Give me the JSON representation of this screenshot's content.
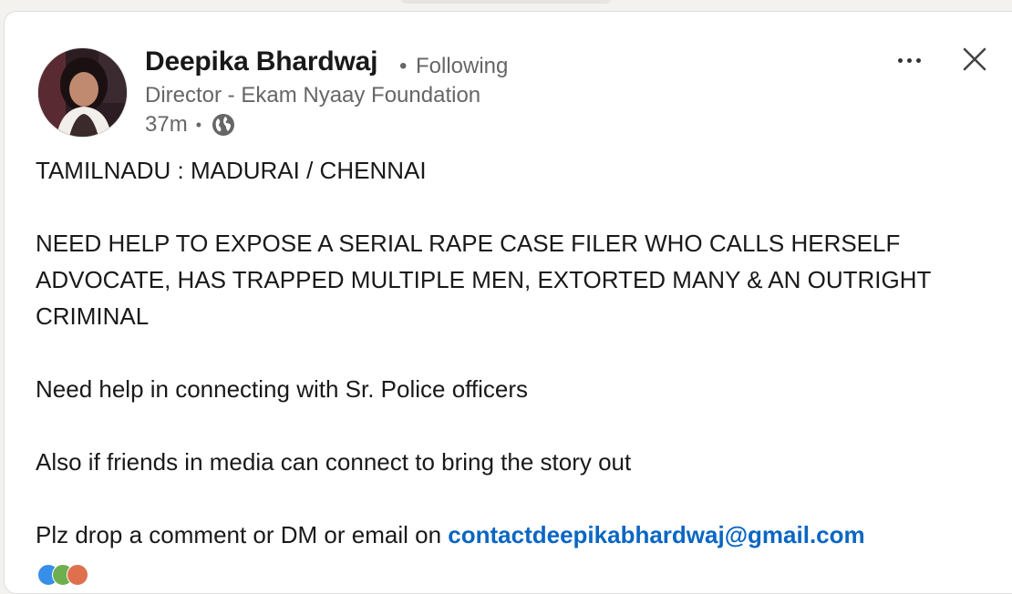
{
  "post": {
    "author": {
      "name": "Deepika Bhardwaj",
      "separator": "•",
      "follow_status": "Following",
      "headline": "Director - Ekam Nyaay Foundation",
      "time": "37m",
      "time_separator": "•",
      "visibility_icon": "globe-icon",
      "avatar_icon": "profile-photo"
    },
    "controls": {
      "more_icon": "more-horizontal-icon",
      "close_icon": "close-icon"
    },
    "body": {
      "line1": "TAMILNADU : MADURAI / CHENNAI",
      "line2": "NEED HELP TO EXPOSE A SERIAL RAPE CASE FILER WHO CALLS HERSELF ADVOCATE, HAS TRAPPED MULTIPLE MEN, EXTORTED MANY & AN OUTRIGHT CRIMINAL",
      "line3": "Need help in connecting with Sr. Police officers",
      "line4": "Also if friends in media can connect to bring the story out",
      "line5_prefix": "Plz drop a comment or DM or email on ",
      "email": "contactdeepikabhardwaj@gmail.com"
    },
    "colors": {
      "link": "#0a66c2",
      "muted_text": "#666666",
      "primary_text": "#1a1a1a",
      "background": "#f3f2ef",
      "card": "#ffffff"
    }
  }
}
